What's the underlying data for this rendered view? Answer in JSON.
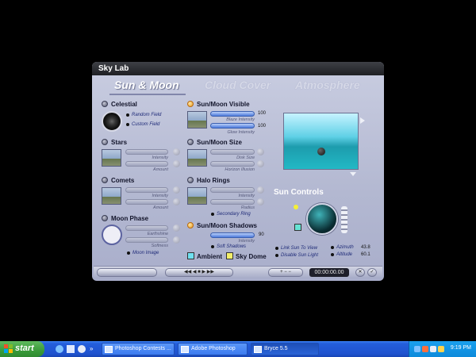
{
  "window": {
    "title": "Sky Lab"
  },
  "tabs": [
    "Sun & Moon",
    "Cloud Cover",
    "Atmosphere"
  ],
  "left_col": {
    "celestial": {
      "label": "Celestial",
      "options": [
        "Random Field",
        "Custom Field"
      ]
    },
    "stars": {
      "label": "Stars",
      "sliders": [
        "Intensity",
        "Amount"
      ]
    },
    "comets": {
      "label": "Comets",
      "sliders": [
        "Intensity",
        "Amount"
      ]
    },
    "moon_phase": {
      "label": "Moon Phase",
      "sliders": [
        "Earthshine",
        "Softness"
      ],
      "option": "Moon Image"
    }
  },
  "right_col": {
    "visible": {
      "label": "Sun/Moon Visible",
      "sliders": [
        "Blaze Intensity",
        "Glow Intensity"
      ],
      "values": [
        "100",
        "100"
      ]
    },
    "size": {
      "label": "Sun/Moon Size",
      "sliders": [
        "Disk Size",
        "Horizon Illusion"
      ]
    },
    "halo": {
      "label": "Halo Rings",
      "sliders": [
        "Intensity",
        "Radius"
      ],
      "option": "Secondary Ring"
    },
    "shadows": {
      "label": "Sun/Moon Shadows",
      "slider": "Intensity",
      "value": "90",
      "option": "Soft Shadows"
    },
    "ambient_label": "Ambient",
    "skydome_label": "Sky Dome"
  },
  "sun_controls": {
    "title": "Sun Controls",
    "options": [
      "Link Sun To View",
      "Disable Sun Light"
    ],
    "azimuth_label": "Azimuth",
    "azimuth_value": "43.8",
    "altitude_label": "Altitude",
    "altitude_value": "60.1"
  },
  "bottom": {
    "time": "00:00:00.00"
  },
  "taskbar": {
    "start": "start",
    "tasks": [
      "Photoshop Contests ...",
      "Adobe Photoshop",
      "Bryce 5.5"
    ],
    "clock": "9:19 PM"
  },
  "colors": {
    "taskbar_blue": "#245edb",
    "start_green": "#3a9b3a",
    "ambient": "#6fe0f0",
    "sky_dome": "#f3ef6a"
  }
}
